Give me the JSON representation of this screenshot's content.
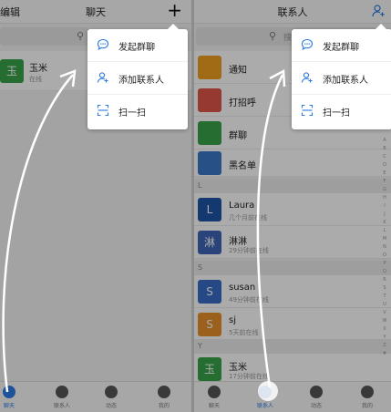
{
  "left": {
    "header": {
      "edit_label": "编辑",
      "title": "聊天",
      "plus_label": "+"
    },
    "conversation": {
      "avatar_text": "玉",
      "avatar_color": "#3aa34a",
      "name": "玉米",
      "subtitle": "在线"
    },
    "tabs": [
      "聊天",
      "联系人",
      "动态",
      "我的"
    ],
    "popup": [
      {
        "icon": "chat-bubble-icon",
        "label": "发起群聊"
      },
      {
        "icon": "add-contact-icon",
        "label": "添加联系人"
      },
      {
        "icon": "scan-icon",
        "label": "扫一扫"
      }
    ]
  },
  "right": {
    "header": {
      "title": "联系人"
    },
    "search": {
      "placeholder": "搜索"
    },
    "top_items": [
      {
        "icon": "notice-icon",
        "color": "#f0a020",
        "label": "通知"
      },
      {
        "icon": "call-icon",
        "color": "#e0554a",
        "label": "打招呼"
      },
      {
        "icon": "group-icon",
        "color": "#3aa34a",
        "label": "群聊"
      },
      {
        "icon": "blacklist-icon",
        "color": "#3b78c8",
        "label": "黑名单"
      }
    ],
    "sections": [
      {
        "letter": "L",
        "contacts": [
          {
            "avatar": "L",
            "color": "#1f56a8",
            "name": "Laura",
            "sub": "几个月前在线"
          },
          {
            "avatar": "淋",
            "color": "#3f66b8",
            "name": "淋淋",
            "sub": "29分钟前在线"
          }
        ]
      },
      {
        "letter": "S",
        "contacts": [
          {
            "avatar": "S",
            "color": "#3a6ec8",
            "name": "susan",
            "sub": "49分钟前在线"
          },
          {
            "avatar": "S",
            "color": "#e8902a",
            "name": "sj",
            "sub": "5天前在线"
          }
        ]
      },
      {
        "letter": "Y",
        "contacts": [
          {
            "avatar": "玉",
            "color": "#3aa34a",
            "name": "玉米",
            "sub": "17分钟前在线"
          }
        ]
      }
    ],
    "alpha": [
      "A",
      "B",
      "C",
      "D",
      "E",
      "F",
      "G",
      "H",
      "I",
      "J",
      "K",
      "L",
      "M",
      "N",
      "O",
      "P",
      "Q",
      "R",
      "S",
      "T",
      "U",
      "V",
      "W",
      "X",
      "Y",
      "Z",
      "#"
    ],
    "tabs": [
      "聊天",
      "联系人",
      "动态",
      "我的"
    ],
    "popup": [
      {
        "icon": "chat-bubble-icon",
        "label": "发起群聊"
      },
      {
        "icon": "add-contact-icon",
        "label": "添加联系人"
      },
      {
        "icon": "scan-icon",
        "label": "扫一扫"
      }
    ]
  },
  "colors": {
    "accent": "#2a7be4",
    "dim": "rgba(0,0,0,0.33)"
  }
}
